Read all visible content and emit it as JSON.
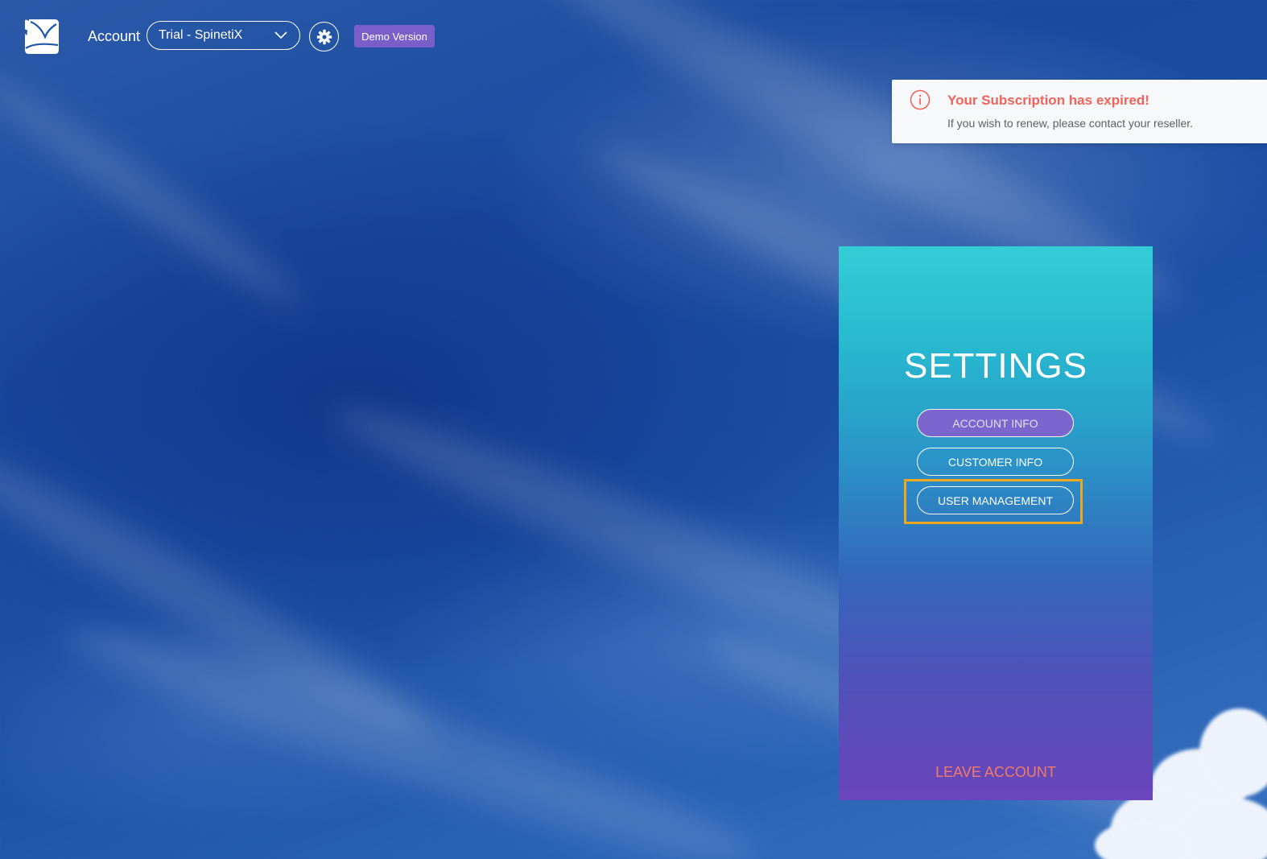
{
  "header": {
    "account_label": "Account",
    "account_select_value": "Trial - SpinetiX",
    "demo_badge": "Demo Version",
    "logo_icon": "app-logo-icon",
    "gear_icon": "gear-icon",
    "chevron_icon": "chevron-down-icon"
  },
  "notification": {
    "title": "Your Subscription has expired!",
    "message": "If you wish to renew, please contact your reseller.",
    "icon": "info-icon",
    "title_color": "#f0645a"
  },
  "settings_panel": {
    "title": "SETTINGS",
    "buttons": [
      {
        "label": "ACCOUNT INFO",
        "active": true
      },
      {
        "label": "CUSTOMER INFO",
        "active": false
      },
      {
        "label": "USER MANAGEMENT",
        "active": false,
        "highlighted": true
      }
    ],
    "leave_label": "LEAVE ACCOUNT",
    "active_color": "#7a66cc",
    "highlight_color": "#f1a71b",
    "leave_color": "#f47a6a"
  }
}
